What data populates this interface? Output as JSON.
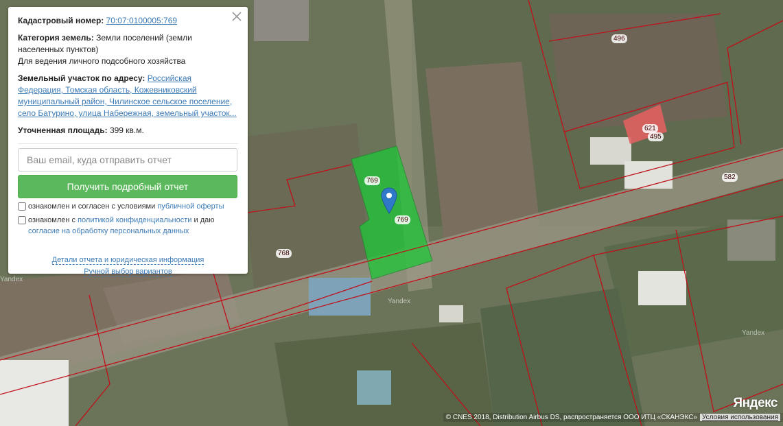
{
  "card": {
    "cadastral_label": "Кадастровый номер:",
    "cadastral_number": "70:07:0100005:769",
    "category_label": "Категория земель:",
    "category_value": "Земли поселений (земли населенных пунктов)",
    "usage": "Для ведения личного подсобного хозяйства",
    "address_label": "Земельный участок по адресу:",
    "address_value": "Российская Федерация, Томская область, Кожевниковский муниципальный район, Чилинское сельское поселение, село Батурино, улица Набережная, земельный участок...",
    "area_label": "Уточненная площадь:",
    "area_value": "399 кв.м.",
    "email_placeholder": "Ваш email, куда отправить отчет",
    "submit_label": "Получить подробный отчет",
    "consent1_text": "ознакомлен и согласен с условиями ",
    "consent1_link": "публичной оферты",
    "consent2_text": "ознакомлен с ",
    "consent2_link1": "политикой конфиденциальности",
    "consent2_mid": " и даю",
    "consent2_link2": "согласие на обработку персональных данных",
    "details_link": "Детали отчета и юридическая информация",
    "manual_link": "Ручной выбор вариантов"
  },
  "map": {
    "plot_labels": {
      "l496": "496",
      "l621": "621",
      "l495": "495",
      "l582": "582",
      "l769a": "769",
      "l769b": "769",
      "l768": "768"
    },
    "watermark": "Yandex",
    "logo": "Яндекс",
    "copyright": "© CNES 2018, Distribution Airbus DS, распространяется ООО ИТЦ «СКАНЭКС»",
    "terms_link": "Условия использования",
    "selected_plot_color": "#22c43a",
    "boundary_color": "#c0101a",
    "highlight_plot_color": "#e06060"
  }
}
